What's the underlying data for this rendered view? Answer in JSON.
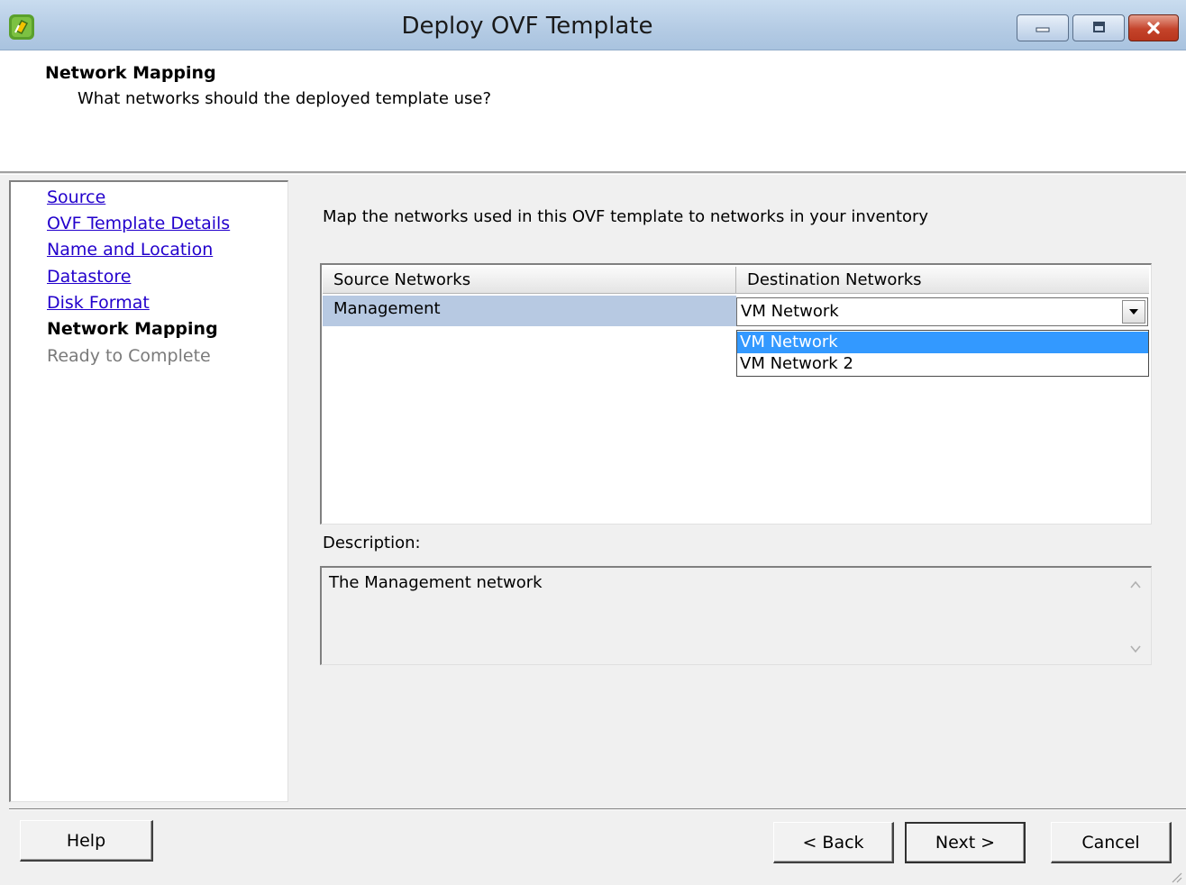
{
  "window": {
    "title": "Deploy OVF Template",
    "icons": {
      "app": "vsphere-app-icon",
      "minimize": "minimize-icon",
      "maximize": "maximize-icon",
      "close": "close-icon"
    }
  },
  "header": {
    "title": "Network Mapping",
    "subtitle": "What networks should the deployed template use?"
  },
  "nav": {
    "items": [
      {
        "label": "Source",
        "state": "link"
      },
      {
        "label": "OVF Template Details",
        "state": "link"
      },
      {
        "label": "Name and Location",
        "state": "link"
      },
      {
        "label": "Datastore",
        "state": "link"
      },
      {
        "label": "Disk Format",
        "state": "link"
      },
      {
        "label": "Network Mapping",
        "state": "current"
      },
      {
        "label": "Ready to Complete",
        "state": "disabled"
      }
    ]
  },
  "main": {
    "instruction": "Map the networks used in this OVF template to networks in your inventory",
    "table": {
      "columns": [
        "Source Networks",
        "Destination Networks"
      ],
      "rows": [
        {
          "source": "Management",
          "destination": "VM Network"
        }
      ]
    },
    "dropdown": {
      "selected": "VM Network",
      "options": [
        "VM Network",
        "VM Network 2"
      ],
      "highlighted": "VM Network"
    },
    "description_label": "Description:",
    "description_text": "The Management network"
  },
  "buttons": {
    "help": "Help",
    "back": "< Back",
    "next": "Next >",
    "cancel": "Cancel"
  },
  "colors": {
    "titlebar": "#b4cbe4",
    "link": "#2200cc",
    "row_selected": "#b7c9e2",
    "dropdown_highlight": "#3399ff",
    "close_button": "#c4432a"
  }
}
